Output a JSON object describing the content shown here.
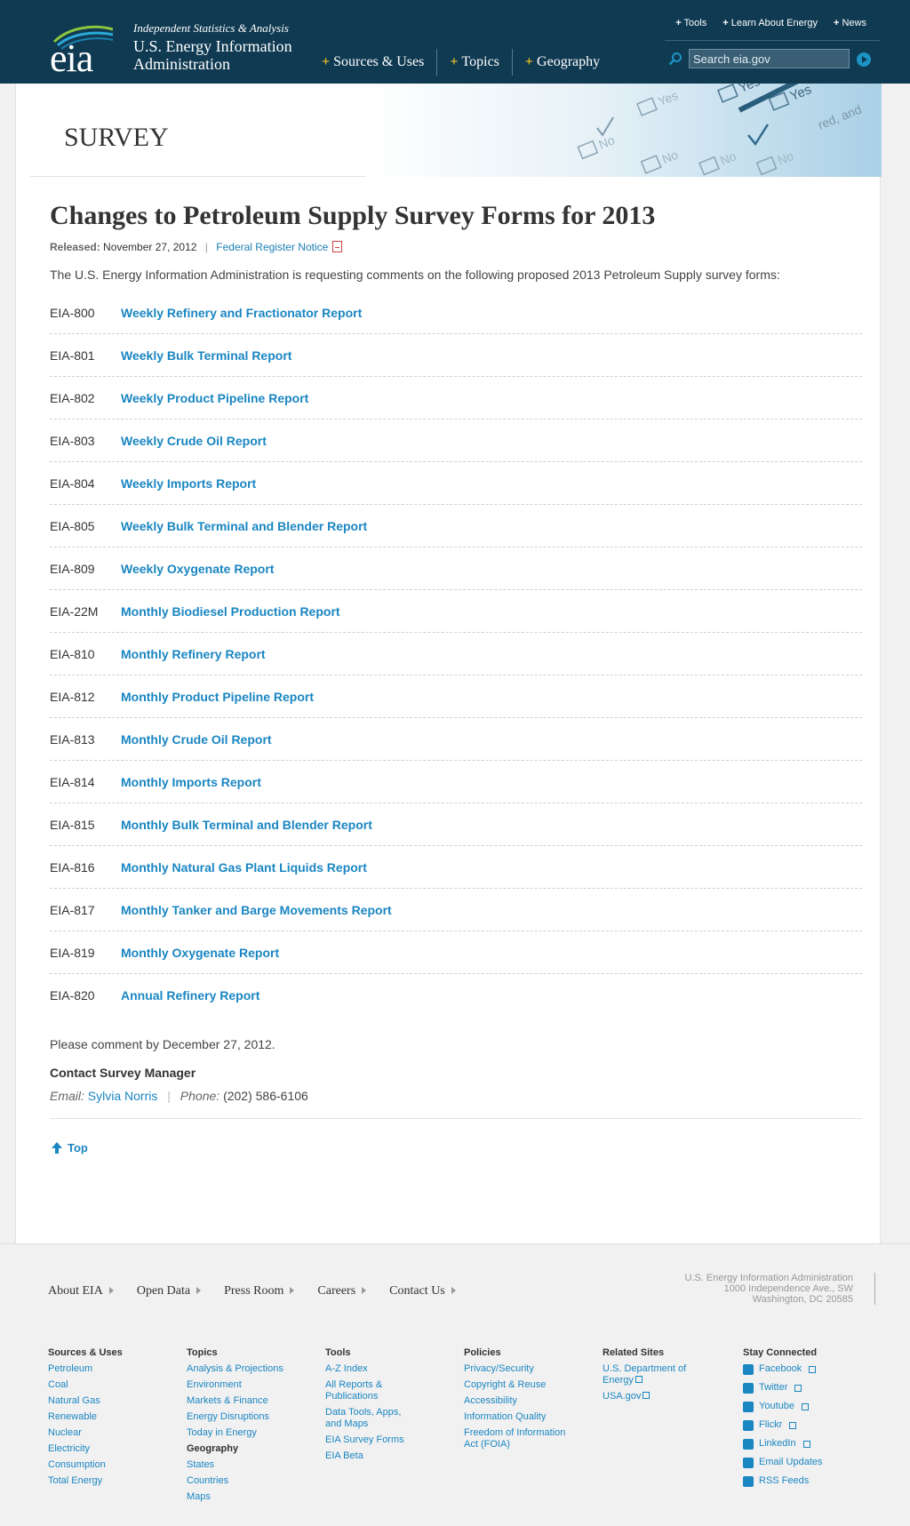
{
  "header": {
    "logo_text": "eia",
    "tagline": "Independent Statistics & Analysis",
    "org_line1": "U.S. Energy Information",
    "org_line2": "Administration",
    "nav": [
      "Sources & Uses",
      "Topics",
      "Geography"
    ],
    "util_nav": [
      "Tools",
      "Learn About Energy",
      "News"
    ],
    "search_placeholder": "Search eia.gov"
  },
  "banner": {
    "section": "SURVEY",
    "art_words": [
      "No",
      "Yes",
      "No",
      "Yes",
      "No",
      "Yes",
      "No",
      "red, and"
    ]
  },
  "article": {
    "title": "Changes to Petroleum Supply Survey Forms for 2013",
    "released_label": "Released:",
    "released_date": "November 27, 2012",
    "separator": "|",
    "notice_link": "Federal Register Notice",
    "intro": "The U.S. Energy Information Administration is requesting comments on the following proposed 2013 Petroleum Supply survey forms:",
    "forms": [
      {
        "code": "EIA-800",
        "name": "Weekly Refinery and Fractionator Report"
      },
      {
        "code": "EIA-801",
        "name": "Weekly Bulk Terminal Report"
      },
      {
        "code": "EIA-802",
        "name": "Weekly Product Pipeline Report"
      },
      {
        "code": "EIA-803",
        "name": "Weekly Crude Oil Report"
      },
      {
        "code": "EIA-804",
        "name": "Weekly Imports Report"
      },
      {
        "code": "EIA-805",
        "name": "Weekly Bulk Terminal and Blender Report"
      },
      {
        "code": "EIA-809",
        "name": "Weekly Oxygenate Report"
      },
      {
        "code": "EIA-22M",
        "name": "Monthly Biodiesel Production Report"
      },
      {
        "code": "EIA-810",
        "name": "Monthly Refinery Report"
      },
      {
        "code": "EIA-812",
        "name": "Monthly Product Pipeline Report"
      },
      {
        "code": "EIA-813",
        "name": "Monthly Crude Oil Report"
      },
      {
        "code": "EIA-814",
        "name": "Monthly Imports Report"
      },
      {
        "code": "EIA-815",
        "name": "Monthly Bulk Terminal and Blender Report"
      },
      {
        "code": "EIA-816",
        "name": "Monthly Natural Gas Plant Liquids Report"
      },
      {
        "code": "EIA-817",
        "name": "Monthly Tanker and Barge Movements Report"
      },
      {
        "code": "EIA-819",
        "name": "Monthly Oxygenate Report"
      },
      {
        "code": "EIA-820",
        "name": "Annual Refinery Report"
      }
    ],
    "deadline": "Please comment by December 27, 2012.",
    "contact_heading": "Contact Survey Manager",
    "email_label": "Email:",
    "email_name": "Sylvia Norris",
    "phone_label": "Phone:",
    "phone": "(202) 586-6106",
    "top_link": "Top"
  },
  "footer": {
    "nav": [
      "About EIA",
      "Open Data",
      "Press Room",
      "Careers",
      "Contact Us"
    ],
    "address": [
      "U.S. Energy Information Administration",
      "1000 Independence Ave., SW",
      "Washington, DC 20585"
    ],
    "columns": {
      "sources": {
        "heading": "Sources & Uses",
        "links": [
          "Petroleum",
          "Coal",
          "Natural Gas",
          "Renewable",
          "Nuclear",
          "Electricity",
          "Consumption",
          "Total Energy"
        ]
      },
      "topics": {
        "heading": "Topics",
        "links": [
          "Analysis & Projections",
          "Environment",
          "Markets & Finance",
          "Energy Disruptions",
          "Today in Energy"
        ],
        "sub_heading": "Geography",
        "sub_links": [
          "States",
          "Countries",
          "Maps"
        ]
      },
      "tools": {
        "heading": "Tools",
        "links": [
          "A-Z Index",
          "All Reports & Publications",
          "Data Tools, Apps, and Maps",
          "EIA Survey Forms",
          "EIA Beta"
        ]
      },
      "policies": {
        "heading": "Policies",
        "links": [
          "Privacy/Security",
          "Copyright & Reuse",
          "Accessibility",
          "Information Quality",
          "Freedom of Information Act (FOIA)"
        ]
      },
      "related": {
        "heading": "Related Sites",
        "links": [
          "U.S. Department of Energy",
          "USA.gov"
        ]
      },
      "connected": {
        "heading": "Stay Connected",
        "links": [
          "Facebook",
          "Twitter",
          "Youtube",
          "Flickr",
          "LinkedIn",
          "Email Updates",
          "RSS Feeds"
        ]
      }
    }
  },
  "colors": {
    "header_bg": "#0f3a52",
    "link": "#1a86c2",
    "accent_plus": "#f3c21f"
  }
}
